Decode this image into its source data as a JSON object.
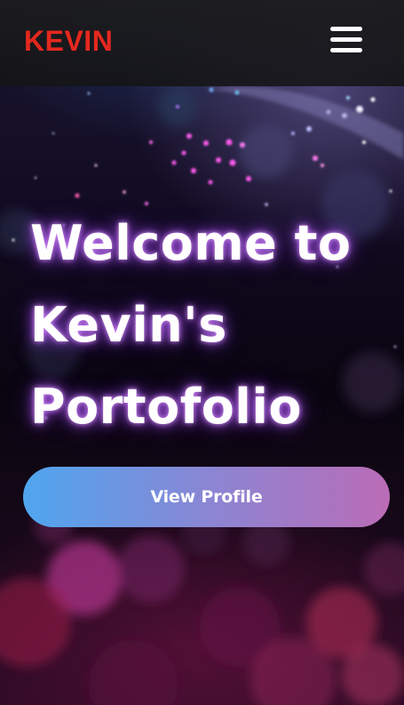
{
  "header": {
    "logo_text": "KEVIN",
    "menu_icon": "hamburger-menu-icon"
  },
  "hero": {
    "title_lines": [
      "Welcome to",
      "Kevin's",
      "Portofolio"
    ],
    "cta_label": "View Profile"
  },
  "colors": {
    "logo": "#e5281e",
    "header_bg": "#1c1c1c",
    "cta_gradient_start": "#4fa6ef",
    "cta_gradient_end": "#bb6cb6",
    "title_glow": "#b45aff"
  }
}
